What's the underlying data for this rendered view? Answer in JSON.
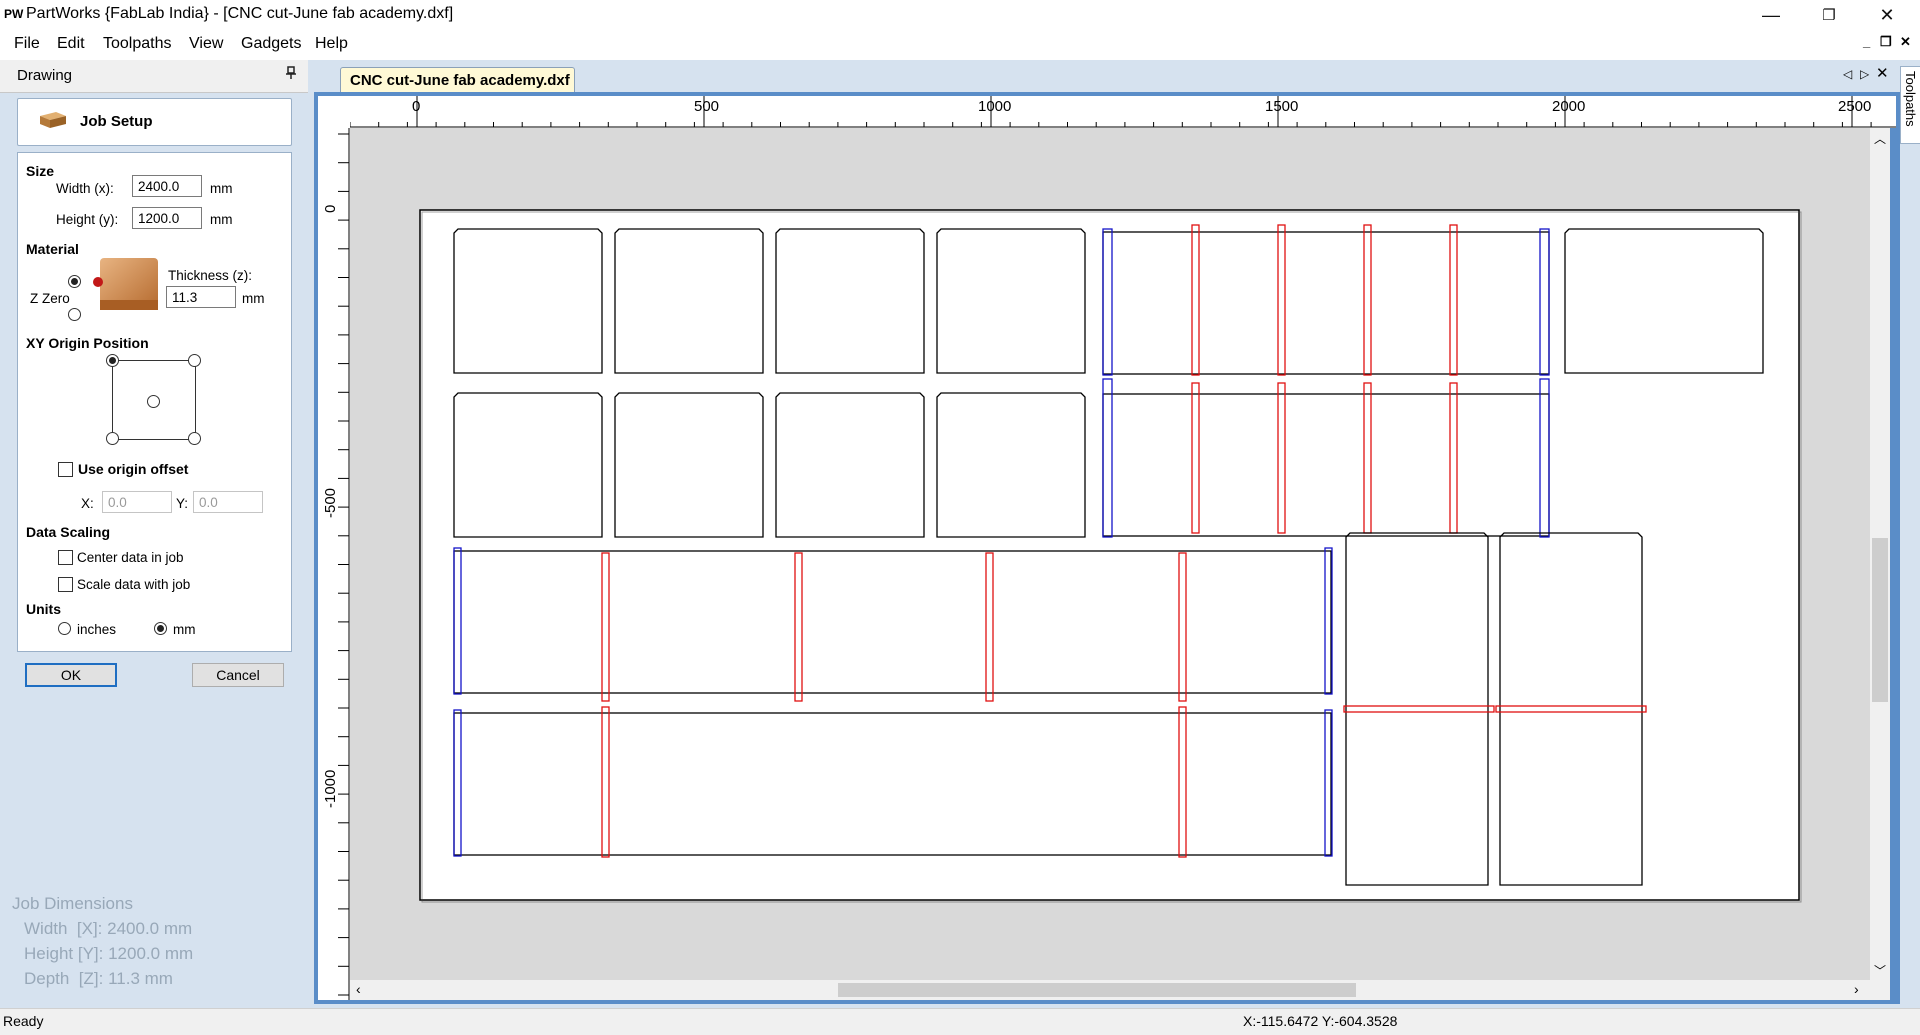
{
  "window": {
    "logo": "PW",
    "title": "PartWorks {FabLab India} - [CNC cut-June fab academy.dxf]",
    "minimize_glyph": "—",
    "maximize_glyph": "❐",
    "close_glyph": "✕"
  },
  "menu": {
    "items": [
      "File",
      "Edit",
      "Toolpaths",
      "View",
      "Gadgets",
      "Help"
    ],
    "mdi_minimize": "_",
    "mdi_restore": "❐",
    "mdi_close": "✕"
  },
  "left_panel": {
    "tab_label": "Drawing",
    "pin_glyph": "📌",
    "job_setup_title": "Job Setup",
    "size": {
      "heading": "Size",
      "width_label": "Width (x):",
      "width_value": "2400.0",
      "height_label": "Height (y):",
      "height_value": "1200.0",
      "unit": "mm"
    },
    "material": {
      "heading": "Material",
      "z_zero_label": "Z Zero",
      "thickness_label": "Thickness (z):",
      "thickness_value": "11.3",
      "unit": "mm",
      "z_zero_top_selected": true
    },
    "xy_origin": {
      "heading": "XY Origin Position",
      "selected": "top-left"
    },
    "origin_offset": {
      "label": "Use origin offset",
      "checked": false,
      "x_label": "X:",
      "x_value": "0.0",
      "y_label": "Y:",
      "y_value": "0.0"
    },
    "data_scaling": {
      "heading": "Data Scaling",
      "center_label": "Center data in job",
      "center_checked": false,
      "scale_label": "Scale data with job",
      "scale_checked": false
    },
    "units": {
      "heading": "Units",
      "inches_label": "inches",
      "mm_label": "mm",
      "selected": "mm"
    },
    "ok_label": "OK",
    "cancel_label": "Cancel",
    "job_dimensions": {
      "heading": "Job Dimensions",
      "width": "Width  [X]: 2400.0 mm",
      "height": "Height [Y]: 1200.0 mm",
      "depth": "Depth  [Z]: 11.3 mm"
    }
  },
  "document": {
    "tab_label": "CNC cut-June fab academy.dxf",
    "ruler_top_labels": [
      "0",
      "500",
      "1000",
      "1500",
      "2000",
      "2500"
    ],
    "ruler_left_labels": [
      "0",
      "-500",
      "-1000"
    ],
    "right_tab_label": "Toolpaths",
    "colors": {
      "outline": "#000000",
      "slot_red": "#e01010",
      "slot_blue": "#1414c8",
      "sheet": "#ffffff",
      "background": "#d9d9d9"
    }
  },
  "status": {
    "left": "Ready",
    "coordinates": "X:-115.6472 Y:-604.3528"
  }
}
